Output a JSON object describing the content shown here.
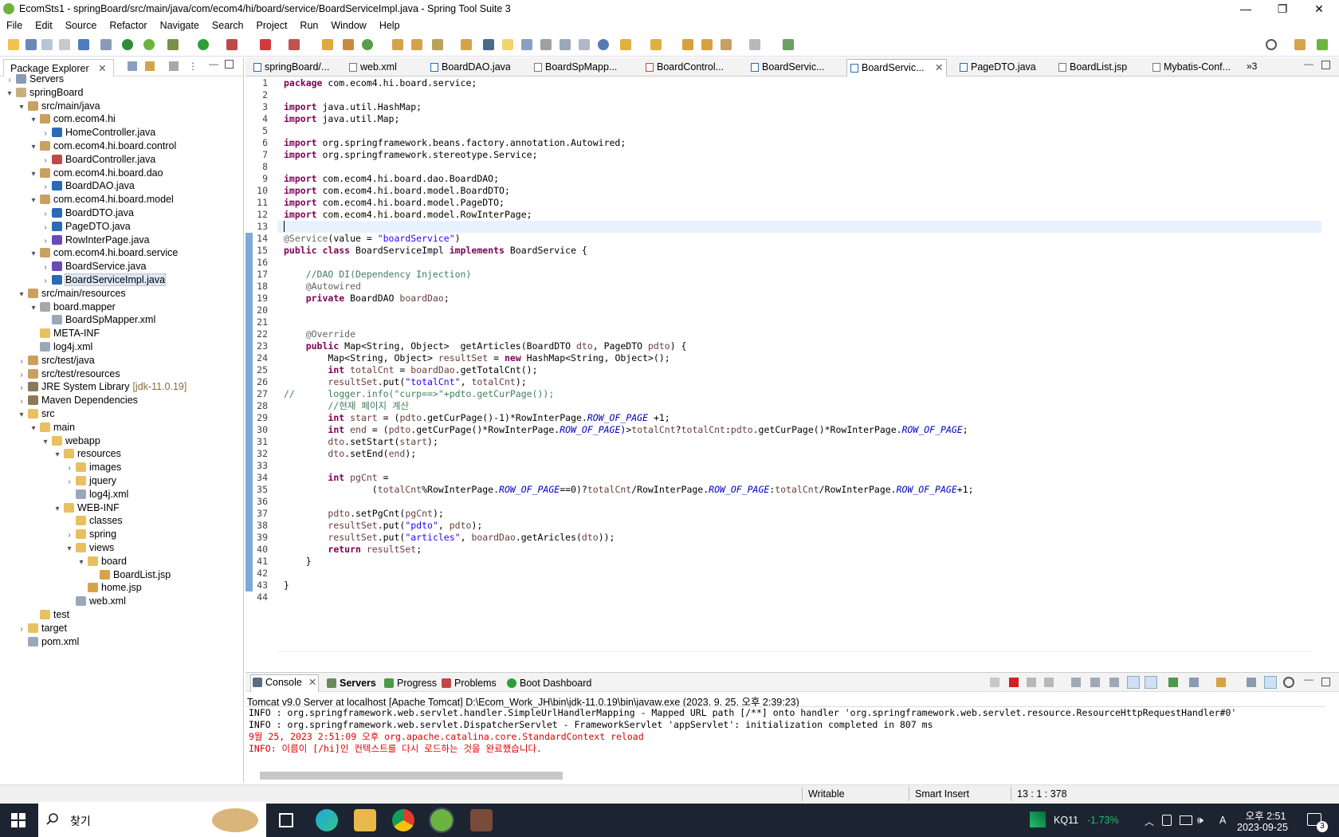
{
  "window": {
    "title": "EcomSts1 - springBoard/src/main/java/com/ecom4/hi/board/service/BoardServiceImpl.java - Spring Tool Suite 3",
    "min": "—",
    "max": "❐",
    "close": "✕"
  },
  "menu": [
    "File",
    "Edit",
    "Source",
    "Refactor",
    "Navigate",
    "Search",
    "Project",
    "Run",
    "Window",
    "Help"
  ],
  "package_explorer": {
    "title": "Package Explorer",
    "close": "✕",
    "items": [
      {
        "label": "Servers",
        "suffix": ""
      },
      {
        "label": "springBoard",
        "suffix": ""
      },
      {
        "label": "src/main/java",
        "suffix": ""
      },
      {
        "label": "com.ecom4.hi",
        "suffix": ""
      },
      {
        "label": "HomeController.java",
        "suffix": ""
      },
      {
        "label": "com.ecom4.hi.board.control",
        "suffix": ""
      },
      {
        "label": "BoardController.java",
        "suffix": ""
      },
      {
        "label": "com.ecom4.hi.board.dao",
        "suffix": ""
      },
      {
        "label": "BoardDAO.java",
        "suffix": ""
      },
      {
        "label": "com.ecom4.hi.board.model",
        "suffix": ""
      },
      {
        "label": "BoardDTO.java",
        "suffix": ""
      },
      {
        "label": "PageDTO.java",
        "suffix": ""
      },
      {
        "label": "RowInterPage.java",
        "suffix": ""
      },
      {
        "label": "com.ecom4.hi.board.service",
        "suffix": ""
      },
      {
        "label": "BoardService.java",
        "suffix": ""
      },
      {
        "label": "BoardServiceImpl.java",
        "suffix": ""
      },
      {
        "label": "src/main/resources",
        "suffix": ""
      },
      {
        "label": "board.mapper",
        "suffix": ""
      },
      {
        "label": "BoardSpMapper.xml",
        "suffix": ""
      },
      {
        "label": "META-INF",
        "suffix": ""
      },
      {
        "label": "log4j.xml",
        "suffix": ""
      },
      {
        "label": "src/test/java",
        "suffix": ""
      },
      {
        "label": "src/test/resources",
        "suffix": ""
      },
      {
        "label": "JRE System Library",
        "suffix": "[jdk-11.0.19]"
      },
      {
        "label": "Maven Dependencies",
        "suffix": ""
      },
      {
        "label": "src",
        "suffix": ""
      },
      {
        "label": "main",
        "suffix": ""
      },
      {
        "label": "webapp",
        "suffix": ""
      },
      {
        "label": "resources",
        "suffix": ""
      },
      {
        "label": "images",
        "suffix": ""
      },
      {
        "label": "jquery",
        "suffix": ""
      },
      {
        "label": "log4j.xml",
        "suffix": ""
      },
      {
        "label": "WEB-INF",
        "suffix": ""
      },
      {
        "label": "classes",
        "suffix": ""
      },
      {
        "label": "spring",
        "suffix": ""
      },
      {
        "label": "views",
        "suffix": ""
      },
      {
        "label": "board",
        "suffix": ""
      },
      {
        "label": "BoardList.jsp",
        "suffix": ""
      },
      {
        "label": "home.jsp",
        "suffix": ""
      },
      {
        "label": "web.xml",
        "suffix": ""
      },
      {
        "label": "test",
        "suffix": ""
      },
      {
        "label": "target",
        "suffix": ""
      },
      {
        "label": "pom.xml",
        "suffix": ""
      }
    ]
  },
  "editor_tabs": [
    "springBoard/...",
    "web.xml",
    "BoardDAO.java",
    "BoardSpMapp...",
    "BoardControl...",
    "BoardServic...",
    "BoardServic...",
    "PageDTO.java",
    "BoardList.jsp",
    "Mybatis-Conf..."
  ],
  "editor_tab_overflow": "»3",
  "editor_tab_close": "✕",
  "code_lines": [
    "package com.ecom4.hi.board.service;",
    "",
    "import java.util.HashMap;",
    "import java.util.Map;",
    "",
    "import org.springframework.beans.factory.annotation.Autowired;",
    "import org.springframework.stereotype.Service;",
    "",
    "import com.ecom4.hi.board.dao.BoardDAO;",
    "import com.ecom4.hi.board.model.BoardDTO;",
    "import com.ecom4.hi.board.model.PageDTO;",
    "import com.ecom4.hi.board.model.RowInterPage;",
    "",
    "@Service(value = \"boardService\")",
    "public class BoardServiceImpl implements BoardService {",
    "",
    "    //DAO DI(Dependency Injection)",
    "    @Autowired",
    "    private BoardDAO boardDao;",
    "",
    "",
    "    @Override",
    "    public Map<String, Object>  getArticles(BoardDTO dto, PageDTO pdto) {",
    "        Map<String, Object> resultSet = new HashMap<String, Object>();",
    "        int totalCnt = boardDao.getTotalCnt();",
    "        resultSet.put(\"totalCnt\", totalCnt);",
    "//      logger.info(\"curp==>\"+pdto.getCurPage());",
    "        //현재 페이지 계산",
    "        int start = (pdto.getCurPage()-1)*RowInterPage.ROW_OF_PAGE +1;",
    "        int end = (pdto.getCurPage()*RowInterPage.ROW_OF_PAGE)>totalCnt?totalCnt:pdto.getCurPage()*RowInterPage.ROW_OF_PAGE;",
    "        dto.setStart(start);",
    "        dto.setEnd(end);",
    "",
    "        int pgCnt =",
    "                (totalCnt%RowInterPage.ROW_OF_PAGE==0)?totalCnt/RowInterPage.ROW_OF_PAGE:totalCnt/RowInterPage.ROW_OF_PAGE+1;",
    "",
    "        pdto.setPgCnt(pgCnt);",
    "        resultSet.put(\"pdto\", pdto);",
    "        resultSet.put(\"articles\", boardDao.getAricles(dto));",
    "        return resultSet;",
    "    }",
    "",
    "}",
    ""
  ],
  "console": {
    "tabs": [
      "Console",
      "Servers",
      "Progress",
      "Problems",
      "Boot Dashboard"
    ],
    "close": "✕",
    "server_line": "Tomcat v9.0 Server at localhost [Apache Tomcat] D:\\Ecom_Work_JH\\bin\\jdk-11.0.19\\bin\\javaw.exe  (2023. 9. 25. 오후 2:39:23)",
    "lines": [
      "INFO : org.springframework.web.servlet.handler.SimpleUrlHandlerMapping - Mapped URL path [/**] onto handler 'org.springframework.web.servlet.resource.ResourceHttpRequestHandler#0'",
      "INFO : org.springframework.web.servlet.DispatcherServlet - FrameworkServlet 'appServlet': initialization completed in 807 ms",
      "9월 25, 2023 2:51:09 오후 org.apache.catalina.core.StandardContext reload",
      "INFO: 이름이 [/hi]인 컨텍스트를 다시 로드하는 것을 완료했습니다."
    ]
  },
  "status": {
    "writable": "Writable",
    "insert": "Smart Insert",
    "position": "13 : 1 : 378"
  },
  "taskbar": {
    "search_placeholder": "찾기",
    "stock": "KQ11",
    "stock_change": "-1.73%",
    "time": "오후 2:51",
    "date": "2023-09-25",
    "lang": "A",
    "notif": "3"
  },
  "colors": {
    "keyword": "#7f0055",
    "string": "#2a00ff",
    "comment": "#3f7f5f",
    "field": "#0000c0",
    "console_error": "#e00000",
    "stock_down": "#1ec26b"
  }
}
